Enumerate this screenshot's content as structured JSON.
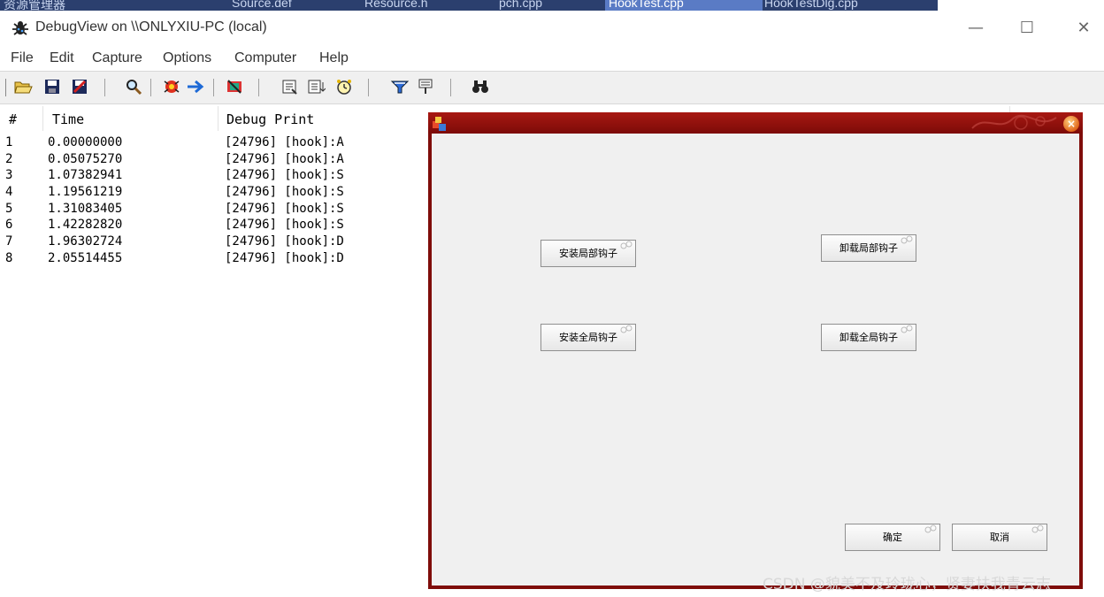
{
  "background_tabs": [
    {
      "label": "资源管理器",
      "highlight": false
    },
    {
      "label": "Source.def",
      "highlight": false
    },
    {
      "label": "Resource.h",
      "highlight": false
    },
    {
      "label": "pch.cpp",
      "highlight": false
    },
    {
      "label": "HookTest.cpp",
      "highlight": true
    },
    {
      "label": "HookTestDlg.cpp",
      "highlight": false
    }
  ],
  "window": {
    "title": "DebugView on \\\\ONLYXIU-PC (local)",
    "minimize": "—",
    "maximize": "☐",
    "close": "✕"
  },
  "menu": [
    "File",
    "Edit",
    "Capture",
    "Options",
    "Computer",
    "Help"
  ],
  "toolbar": {
    "icons": [
      "open-icon",
      "save-icon",
      "save-clear-icon",
      "find-icon",
      "capture-icon",
      "autoscroll-icon",
      "clear-display-icon",
      "history-icon",
      "properties-icon",
      "clock-time-icon",
      "filter-icon",
      "highlight-icon",
      "find-binoculars-icon"
    ]
  },
  "list": {
    "columns": [
      "#",
      "Time",
      "Debug Print"
    ],
    "rows": [
      {
        "num": "1",
        "time": "0.00000000",
        "print": "[24796]  [hook]:A"
      },
      {
        "num": "2",
        "time": "0.05075270",
        "print": "[24796]  [hook]:A"
      },
      {
        "num": "3",
        "time": "1.07382941",
        "print": "[24796]  [hook]:S"
      },
      {
        "num": "4",
        "time": "1.19561219",
        "print": "[24796]  [hook]:S"
      },
      {
        "num": "5",
        "time": "1.31083405",
        "print": "[24796]  [hook]:S"
      },
      {
        "num": "6",
        "time": "1.42282820",
        "print": "[24796]  [hook]:S"
      },
      {
        "num": "7",
        "time": "1.96302724",
        "print": "[24796]  [hook]:D"
      },
      {
        "num": "8",
        "time": "2.05514455",
        "print": "[24796]  [hook]:D"
      }
    ]
  },
  "dialog": {
    "close": "×",
    "buttons": {
      "install_local": "安装局部钩子",
      "uninstall_local": "卸载局部钩子",
      "install_global": "安装全局钩子",
      "uninstall_global": "卸载全局钩子",
      "ok": "确定",
      "cancel": "取消"
    }
  },
  "watermark": "CSDN @貌美不及玲珑心，贤妻扶我青云志"
}
